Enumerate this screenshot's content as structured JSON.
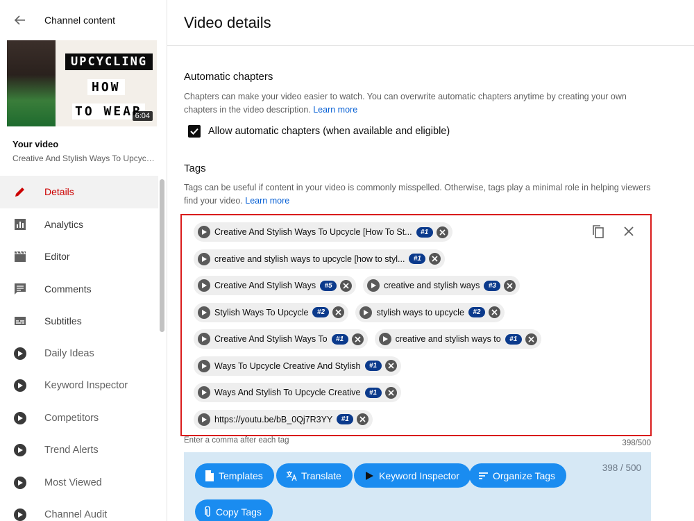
{
  "sidebar": {
    "header_title": "Channel content",
    "thumbnail": {
      "line1": "UPCYCLING",
      "line2": "HOW",
      "line3": "TO WEAR",
      "duration": "6:04"
    },
    "your_video_label": "Your video",
    "video_title": "Creative And Stylish Ways To Upcycle [How To Style Upcycled Clothing]",
    "nav": [
      {
        "label": "Details",
        "icon": "pencil-icon",
        "active": true
      },
      {
        "label": "Analytics",
        "icon": "analytics-icon"
      },
      {
        "label": "Editor",
        "icon": "clapperboard-icon"
      },
      {
        "label": "Comments",
        "icon": "comment-icon"
      },
      {
        "label": "Subtitles",
        "icon": "subtitles-icon"
      },
      {
        "label": "Daily Ideas",
        "icon": "vidiq-icon"
      },
      {
        "label": "Keyword Inspector",
        "icon": "vidiq-icon"
      },
      {
        "label": "Competitors",
        "icon": "vidiq-icon"
      },
      {
        "label": "Trend Alerts",
        "icon": "vidiq-icon"
      },
      {
        "label": "Most Viewed",
        "icon": "vidiq-icon"
      },
      {
        "label": "Channel Audit",
        "icon": "vidiq-icon"
      }
    ]
  },
  "main": {
    "title": "Video details",
    "chapters": {
      "title": "Automatic chapters",
      "desc": "Chapters can make your video easier to watch. You can overwrite automatic chapters anytime by creating your own chapters in the video description.",
      "learn_more": "Learn more",
      "checkbox_label": "Allow automatic chapters (when available and eligible)",
      "checked": true
    },
    "tags": {
      "title": "Tags",
      "desc": "Tags can be useful if content in your video is commonly misspelled. Otherwise, tags play a minimal role in helping viewers find your video.",
      "learn_more": "Learn more",
      "rows": [
        [
          {
            "text": "Creative And Stylish Ways To Upcycle [How To St...",
            "rank": "#1"
          }
        ],
        [
          {
            "text": "creative and stylish ways to upcycle [how to styl...",
            "rank": "#1"
          }
        ],
        [
          {
            "text": "Creative And Stylish Ways",
            "rank": "#5"
          },
          {
            "text": "creative and stylish ways",
            "rank": "#3"
          }
        ],
        [
          {
            "text": "Stylish Ways To Upcycle",
            "rank": "#2"
          },
          {
            "text": "stylish ways to upcycle",
            "rank": "#2"
          }
        ],
        [
          {
            "text": "Creative And Stylish Ways To",
            "rank": "#1"
          },
          {
            "text": "creative and stylish ways to",
            "rank": "#1"
          }
        ],
        [
          {
            "text": "Ways To Upcycle Creative And Stylish",
            "rank": "#1"
          }
        ],
        [
          {
            "text": "Ways And Stylish To Upcycle Creative",
            "rank": "#1"
          }
        ],
        [
          {
            "text": "https://youtu.be/bB_0Qj7R3YY",
            "rank": "#1"
          }
        ]
      ],
      "hint": "Enter a comma after each tag",
      "count": "398/500"
    },
    "panel": {
      "buttons": {
        "templates": "Templates",
        "translate": "Translate",
        "keyword_inspector": "Keyword Inspector",
        "organize_tags": "Organize Tags",
        "copy_tags": "Copy Tags"
      },
      "count": "398 / 500"
    }
  },
  "colors": {
    "accent_red": "#cc0000",
    "link_blue": "#065fd4",
    "badge_navy": "#0b3a8c",
    "button_blue": "#1a8cf0",
    "panel_bg": "#d6e8f5",
    "highlight_border": "#d91c1c"
  }
}
